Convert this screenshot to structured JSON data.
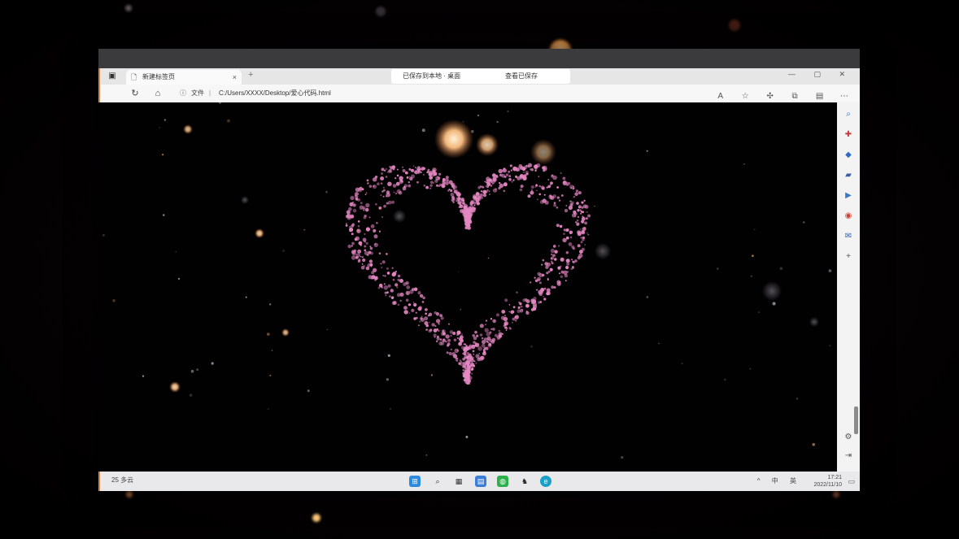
{
  "browser": {
    "tab": {
      "title": "新建标签页",
      "close": "×",
      "new_tab": "+"
    },
    "notification": {
      "left_text": "已保存到本地 · 桌面",
      "right_text": "查看已保存"
    },
    "window_controls": "— ▢ ✕",
    "address": {
      "info_icon": "ⓘ",
      "label": "文件",
      "separator": "|",
      "url": "C:/Users/XXXX/Desktop/爱心代码.html"
    },
    "toolbar_icons": [
      "read-aloud-icon",
      "favorite-icon",
      "extensions-icon",
      "collections-icon",
      "profile-icon",
      "more-icon"
    ],
    "sidebar_icons": [
      "search-icon",
      "add-icon",
      "shopping-icon",
      "chat-icon",
      "games-icon",
      "office-icon",
      "outlook-icon",
      "more-icon"
    ]
  },
  "taskbar": {
    "weather_temp": "25",
    "weather_desc": "多云",
    "tray": "^ 中 英",
    "clock_time": "17:21",
    "clock_date": "2022/11/10"
  },
  "colors": {
    "heart": "#e487c2",
    "bokeh_warm": "#ffb76b",
    "frame_accent": "#c98a52"
  }
}
